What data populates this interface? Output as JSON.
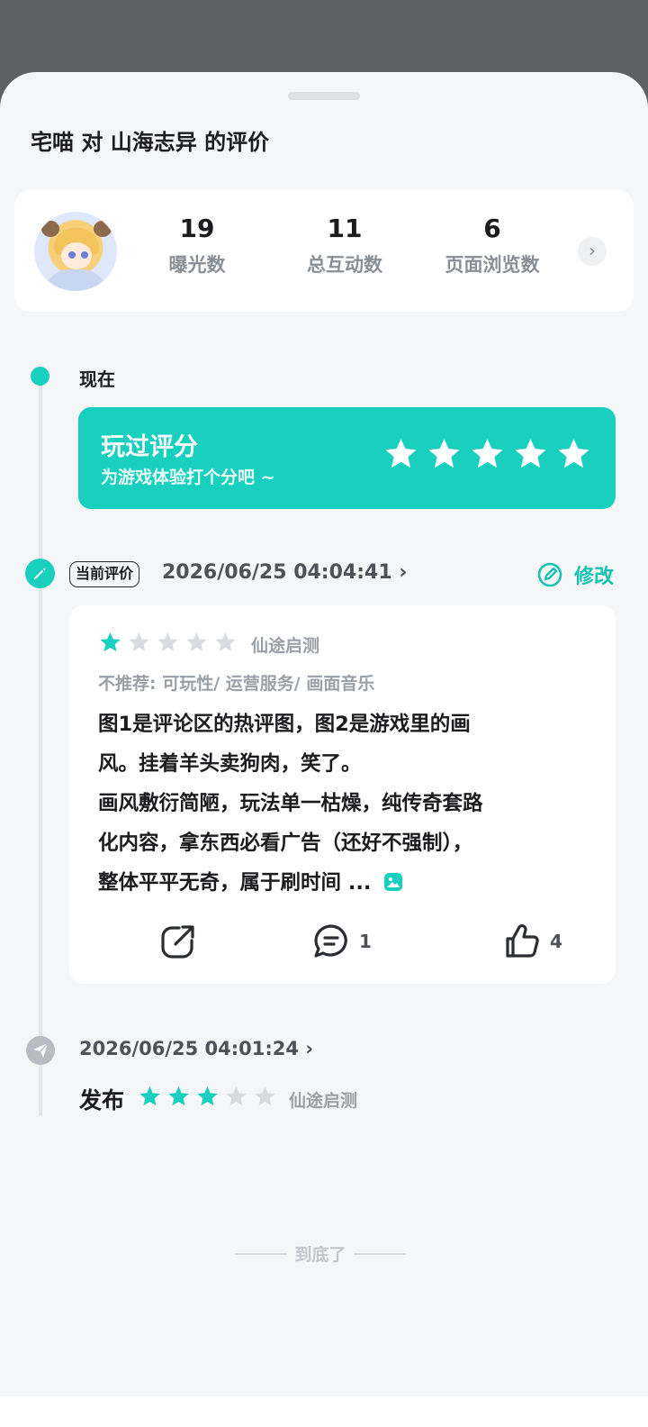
{
  "sheet": {
    "title": "宅喵 对 山海志异 的评价"
  },
  "stats": [
    {
      "value": "19",
      "label": "曝光数"
    },
    {
      "value": "11",
      "label": "总互动数"
    },
    {
      "value": "6",
      "label": "页面浏览数"
    }
  ],
  "timeline": {
    "now_label": "现在",
    "rate_card": {
      "title": "玩过评分",
      "subtitle": "为游戏体验打个分吧 ~",
      "star_count": 5
    },
    "current": {
      "badge": "当前评价",
      "time": "2026/06/25 04:04:41",
      "edit_label": "修改",
      "review": {
        "rating": 1,
        "max_rating": 5,
        "tag": "仙途启测",
        "not_recommend": "不推荐: 可玩性/ 运营服务/ 画面音乐",
        "lines": [
          "图1是评论区的热评图，图2是游戏里的画",
          "风。挂着羊头卖狗肉，笑了。",
          "画风敷衍简陋，玩法单一枯燥，纯传奇套路",
          "化内容，拿东西必看广告（还好不强制），",
          "整体平平无奇，属于刷时间 ..."
        ],
        "comments": "1",
        "likes": "4"
      }
    },
    "published": {
      "time": "2026/06/25 04:01:24",
      "label": "发布",
      "rating": 3,
      "max_rating": 5,
      "tag": "仙途启测"
    }
  },
  "footer": {
    "end_text": "到底了"
  },
  "colors": {
    "accent": "#18d0bd",
    "star_empty": "#d8dbe0",
    "background": "#f4f6f8"
  },
  "icons": {
    "chevron": "›",
    "share": "share-icon",
    "comment": "comment-icon",
    "like": "thumbs-up-icon"
  }
}
